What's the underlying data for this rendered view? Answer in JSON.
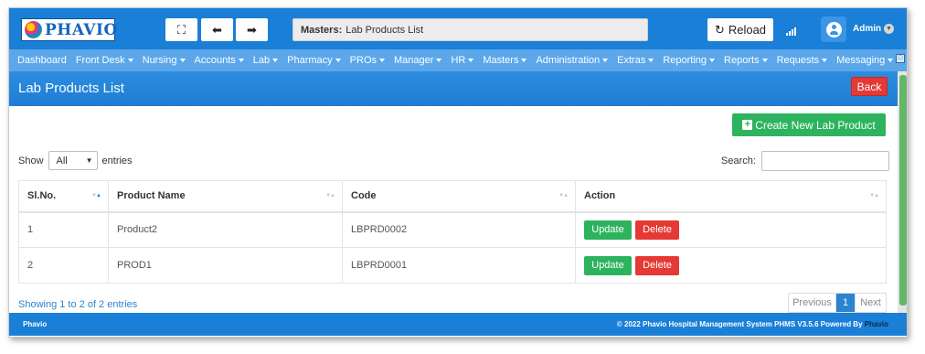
{
  "header": {
    "logo_text": "PHAVIO",
    "fullscreen_icon": "expand-icon",
    "back_icon": "arrow-left-icon",
    "forward_icon": "arrow-right-icon",
    "breadcrumb_label": "Masters:",
    "breadcrumb_value": "Lab Products List",
    "reload_label": "Reload",
    "user_name": "Admin"
  },
  "menu": [
    {
      "label": "Dashboard",
      "dropdown": false
    },
    {
      "label": "Front Desk",
      "dropdown": true
    },
    {
      "label": "Nursing",
      "dropdown": true
    },
    {
      "label": "Accounts",
      "dropdown": true
    },
    {
      "label": "Lab",
      "dropdown": true
    },
    {
      "label": "Pharmacy",
      "dropdown": true
    },
    {
      "label": "PROs",
      "dropdown": true
    },
    {
      "label": "Manager",
      "dropdown": true
    },
    {
      "label": "HR",
      "dropdown": true
    },
    {
      "label": "Masters",
      "dropdown": true
    },
    {
      "label": "Administration",
      "dropdown": true
    },
    {
      "label": "Extras",
      "dropdown": true
    },
    {
      "label": "Reporting",
      "dropdown": true
    },
    {
      "label": "Reports",
      "dropdown": true
    },
    {
      "label": "Requests",
      "dropdown": true
    },
    {
      "label": "Messaging",
      "dropdown": true
    }
  ],
  "page": {
    "title": "Lab Products List",
    "back_label": "Back",
    "create_label": "Create New Lab Product"
  },
  "table_controls": {
    "show_label": "Show",
    "entries_value": "All",
    "entries_label": "entries",
    "search_label": "Search:",
    "search_value": ""
  },
  "table": {
    "columns": [
      "Sl.No.",
      "Product Name",
      "Code",
      "Action"
    ],
    "rows": [
      {
        "sl": "1",
        "name": "Product2",
        "code": "LBPRD0002"
      },
      {
        "sl": "2",
        "name": "PROD1",
        "code": "LBPRD0001"
      }
    ],
    "update_label": "Update",
    "delete_label": "Delete"
  },
  "pagination": {
    "info": "Showing 1 to 2 of 2 entries",
    "previous": "Previous",
    "current": "1",
    "next": "Next"
  },
  "footer": {
    "left": "Phavio",
    "right": "© 2022 Phavio Hospital Management System PHMS V3.5.6 Powered By",
    "brand": "Phavio"
  },
  "colors": {
    "primary": "#1a7fd6",
    "menu": "#5ba7ea",
    "success": "#2db35d",
    "danger": "#e53935"
  }
}
